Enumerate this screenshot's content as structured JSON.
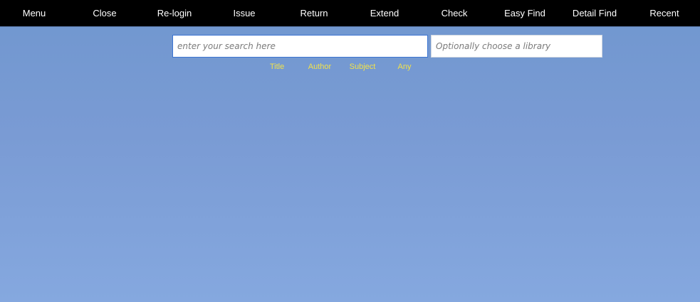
{
  "nav": {
    "items": [
      {
        "label": "Menu"
      },
      {
        "label": "Close"
      },
      {
        "label": "Re-login"
      },
      {
        "label": "Issue"
      },
      {
        "label": "Return"
      },
      {
        "label": "Extend"
      },
      {
        "label": "Check"
      },
      {
        "label": "Easy Find"
      },
      {
        "label": "Detail Find"
      },
      {
        "label": "Recent"
      }
    ]
  },
  "search": {
    "placeholder": "enter your search here",
    "value": "",
    "filters": [
      {
        "label": "Title"
      },
      {
        "label": "Author"
      },
      {
        "label": "Subject"
      },
      {
        "label": "Any"
      }
    ]
  },
  "library": {
    "placeholder": "Optionally choose a library",
    "value": ""
  },
  "colors": {
    "nav_background": "#000000",
    "nav_text": "#ffffff",
    "page_background": "#7a9bd0",
    "filter_text": "#f2e24a",
    "search_border": "#3b74d1"
  }
}
